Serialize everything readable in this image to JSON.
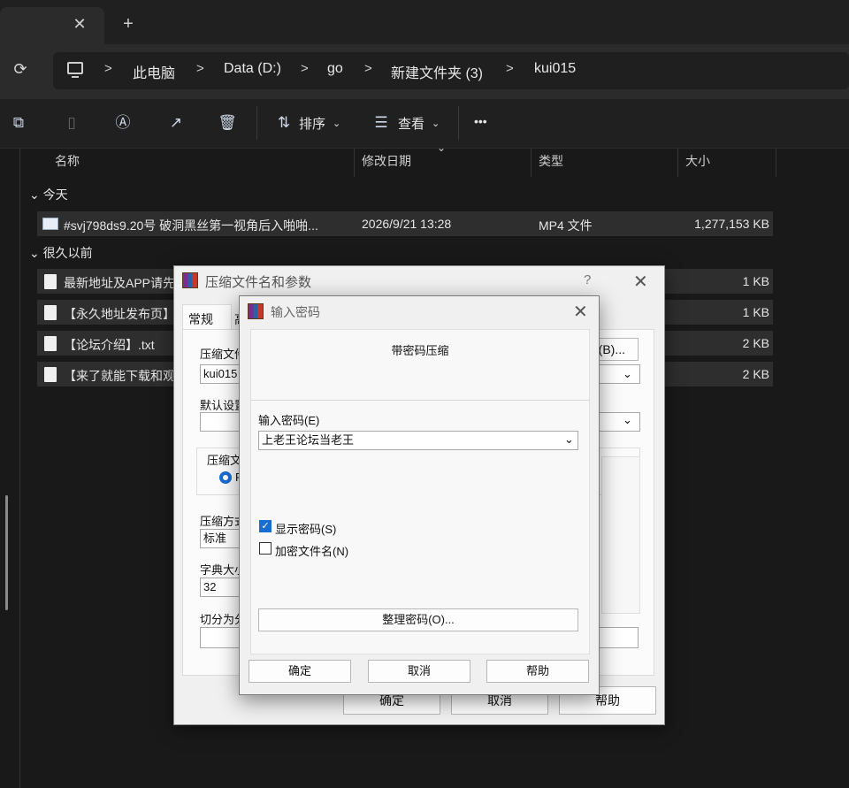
{
  "tabs": {
    "close_glyph": "✕",
    "new_glyph": "+"
  },
  "breadcrumb": [
    "此电脑",
    "Data (D:)",
    "go",
    "新建文件夹 (3)",
    "kui015"
  ],
  "toolbar": {
    "sort_label": "排序",
    "view_label": "查看",
    "more_label": "•••"
  },
  "columns": {
    "name": "名称",
    "modified": "修改日期",
    "type": "类型",
    "size": "大小"
  },
  "groups": {
    "today": "今天",
    "long_ago": "很久以前"
  },
  "files": [
    {
      "name": "#svj798ds9.20号 破洞黑丝第一视角后入啪啪...",
      "date": "2026/9/21 13:28",
      "type": "MP4 文件",
      "size": "1,277,153 KB",
      "icon": "video-file-icon"
    },
    {
      "name": "最新地址及APP请先",
      "size": "1 KB",
      "icon": "text-file-icon"
    },
    {
      "name": "【永久地址发布页】",
      "size": "1 KB",
      "icon": "text-file-icon"
    },
    {
      "name": "【论坛介绍】.txt",
      "size": "2 KB",
      "icon": "text-file-icon"
    },
    {
      "name": "【来了就能下载和观",
      "size": "2 KB",
      "icon": "text-file-icon"
    }
  ],
  "archive_dialog": {
    "title": "压缩文件名和参数",
    "help_glyph": "?",
    "close_glyph": "✕",
    "tab_general": "常规",
    "tab_adv": "高",
    "archive_name_label": "压缩文件",
    "archive_name_value": "kui015",
    "browse_label": "(B)...",
    "default_settings_label": "默认设置",
    "format_group_label": "压缩文",
    "format_radio_text": "R",
    "method_label": "压缩方式",
    "method_value": "标准",
    "dict_label": "字典大小",
    "dict_value": "32",
    "split_label": "切分为分",
    "ok": "确定",
    "cancel": "取消",
    "help": "帮助"
  },
  "password_dialog": {
    "title": "输入密码",
    "close_glyph": "✕",
    "heading": "带密码压缩",
    "password_label": "输入密码(E)",
    "password_value": "上老王论坛当老王",
    "show_password": "显示密码(S)",
    "encrypt_names": "加密文件名(N)",
    "organize_button": "整理密码(O)...",
    "ok": "确定",
    "cancel": "取消",
    "help": "帮助"
  }
}
